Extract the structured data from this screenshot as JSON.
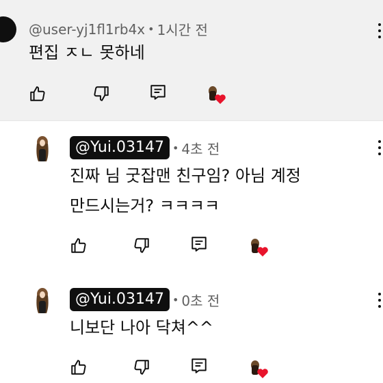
{
  "top_comment": {
    "handle": "@user-yj1fl1rb4x",
    "separator": "•",
    "time": "1시간 전",
    "text": "편집 ㅈㄴ 못하네"
  },
  "replies": [
    {
      "handle": "@Yui.03147",
      "separator": "•",
      "time": "4초 전",
      "text_line1": "진짜 님 굿잡맨 친구임? 아님 계정",
      "text_line2": "만드시는거? ㅋㅋㅋㅋ"
    },
    {
      "handle": "@Yui.03147",
      "separator": "•",
      "time": "0초 전",
      "text_line1": "니보단 나아 닥쳐^^"
    }
  ],
  "icons": {
    "like": "thumbs-up-icon",
    "dislike": "thumbs-down-icon",
    "reply": "reply-comment-icon",
    "creator_heart": "creator-heart-icon",
    "more": "more-vertical-icon"
  },
  "colors": {
    "highlight_bg": "#f1f1f1",
    "heart": "#e8142c",
    "text": "#0f0f0f",
    "meta": "#606060"
  }
}
